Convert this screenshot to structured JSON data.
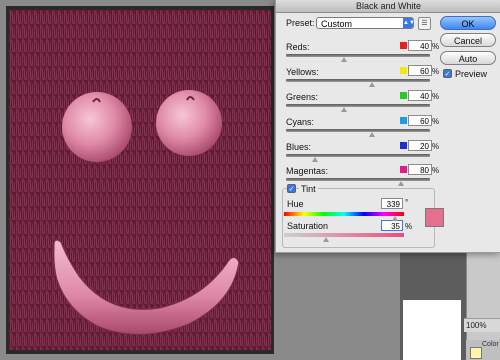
{
  "dialog": {
    "title": "Black and White",
    "preset_label": "Preset:",
    "preset_value": "Custom",
    "buttons": {
      "ok": "OK",
      "cancel": "Cancel",
      "auto": "Auto"
    },
    "preview_label": "Preview",
    "preview_checked": true
  },
  "sliders": [
    {
      "name": "Reds:",
      "value": "40",
      "unit": "%",
      "color": "#e8221e",
      "position_percent": 40
    },
    {
      "name": "Yellows:",
      "value": "60",
      "unit": "%",
      "color": "#f3e90d",
      "position_percent": 60
    },
    {
      "name": "Greens:",
      "value": "40",
      "unit": "%",
      "color": "#27c927",
      "position_percent": 40
    },
    {
      "name": "Cyans:",
      "value": "60",
      "unit": "%",
      "color": "#1e9be4",
      "position_percent": 60
    },
    {
      "name": "Blues:",
      "value": "20",
      "unit": "%",
      "color": "#1f2fcf",
      "position_percent": 20
    },
    {
      "name": "Magentas:",
      "value": "80",
      "unit": "%",
      "color": "#e21b8a",
      "position_percent": 80
    }
  ],
  "tint": {
    "label": "Tint",
    "checked": true,
    "hue_label": "Hue",
    "hue_value": "339",
    "hue_unit": "°",
    "saturation_label": "Saturation",
    "saturation_value": "35",
    "saturation_unit": "%",
    "swatch_color": "#e4708e"
  },
  "workspace": {
    "zoom": "100%",
    "panel_tab": "Color"
  },
  "colors": {
    "photo_tint": "#6a1f3a",
    "accent_blue": "#3b78e7"
  }
}
